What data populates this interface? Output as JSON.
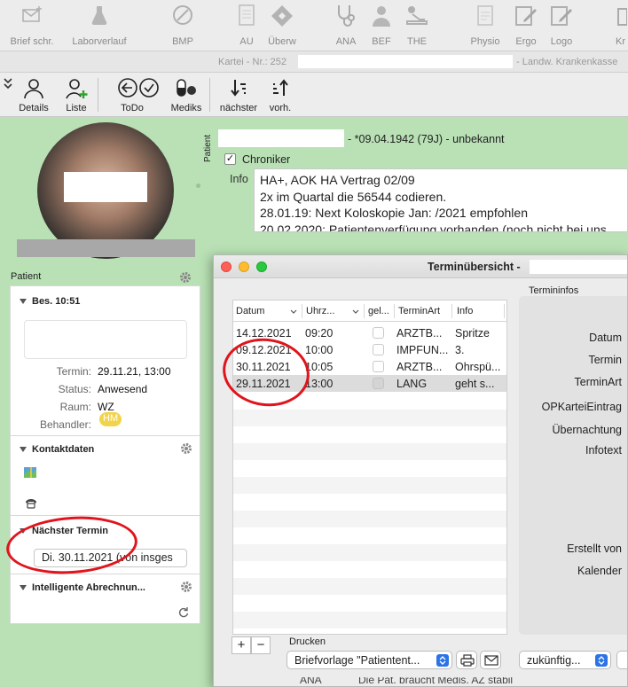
{
  "toolbar_top": [
    {
      "label": "Brief schr.",
      "icon": "envelope-icon"
    },
    {
      "label": "Laborverlauf",
      "icon": "flask-icon"
    },
    {
      "label": "BMP",
      "icon": "pill-icon"
    },
    {
      "label": "AU",
      "icon": "document-icon"
    },
    {
      "label": "Überw",
      "icon": "referral-icon"
    },
    {
      "label": "ANA",
      "icon": "stethoscope-icon"
    },
    {
      "label": "BEF",
      "icon": "doctor-icon"
    },
    {
      "label": "THE",
      "icon": "therapy-icon"
    },
    {
      "label": "Physio",
      "icon": "physio-form-icon"
    },
    {
      "label": "Ergo",
      "icon": "edit-form-icon"
    },
    {
      "label": "Logo",
      "icon": "edit-form-icon"
    },
    {
      "label": "Kr",
      "icon": "hospital-icon"
    }
  ],
  "kartei": {
    "prefix": "Kartei - Nr.: 252",
    "insurer": "- Landw. Krankenkasse"
  },
  "toolbar2": [
    {
      "label": "Details",
      "icon": "person-icon"
    },
    {
      "label": "Liste",
      "icon": "person-add-icon"
    },
    {
      "label": "ToDo",
      "icon": "back-arrow-icon"
    },
    {
      "label": "Mediks",
      "icon": "pills-icon"
    },
    {
      "label": "nächster",
      "icon": "sort-down-icon"
    },
    {
      "label": "vorh.",
      "icon": "sort-up-icon"
    }
  ],
  "left_panel": {
    "patient_header": "Patient",
    "visit": {
      "title": "Bes. 10:51",
      "termin_label": "Termin:",
      "termin_value": "29.11.21, 13:00",
      "status_label": "Status:",
      "status_value": "Anwesend",
      "raum_label": "Raum:",
      "raum_value": "WZ",
      "behandler_label": "Behandler:",
      "behandler_value": "HM"
    },
    "kontakt_title": "Kontaktdaten",
    "naechster_title": "Nächster Termin",
    "naechster_value": "Di. 30.11.2021 (von insges",
    "abrechnung_title": "Intelligente Abrechnun..."
  },
  "patient": {
    "vertical_label": "Patient",
    "dob": "- *09.04.1942 (79J) - unbekannt",
    "chroniker_label": "Chroniker",
    "chroniker_checked": "✓",
    "info_label": "Info",
    "info_lines": [
      "HA+, AOK HA Vertrag 02/09",
      "2x im Quartal die 56544 codieren.",
      "28.01.19: Next Koloskopie Jan: /2021 empfohlen",
      "20.02.2020: Patientenverfügung vorhanden (noch nicht bei uns"
    ]
  },
  "dialog": {
    "title": "Terminübersicht -",
    "termininfos_label": "Termininfos",
    "columns": [
      "Datum",
      "Uhrz...",
      "gel...",
      "TerminArt",
      "Info"
    ],
    "rows": [
      {
        "datum": "14.12.2021",
        "uhrzeit": "09:20",
        "art": "ARZTB...",
        "info": "Spritze"
      },
      {
        "datum": "09.12.2021",
        "uhrzeit": "10:00",
        "art": "IMPFUN...",
        "info": "3."
      },
      {
        "datum": "30.11.2021",
        "uhrzeit": "10:05",
        "art": "ARZTB...",
        "info": "Ohrspü..."
      },
      {
        "datum": "29.11.2021",
        "uhrzeit": "13:00",
        "art": "LANG",
        "info": "geht s..."
      }
    ],
    "info_fields": [
      "Datum",
      "Termin",
      "TerminArt",
      "OPKarteiEintrag",
      "Übernachtung",
      "Infotext",
      "Erstellt von",
      "Kalender"
    ],
    "add_label": "+",
    "remove_label": "−",
    "drucken_label": "Drucken",
    "brief_select": "Briefvorlage \"Patientent...",
    "filter_select": "zukünftig..."
  },
  "bottom_strip": {
    "left": "ANA",
    "text": "Die Pat. braucht Medis. AZ stabil"
  },
  "colors": {
    "sidebar_green": "#b9e1b5",
    "highlight_red": "#e0141c",
    "accent_blue": "#2b73e6",
    "badge_yellow": "#f2d44a"
  }
}
